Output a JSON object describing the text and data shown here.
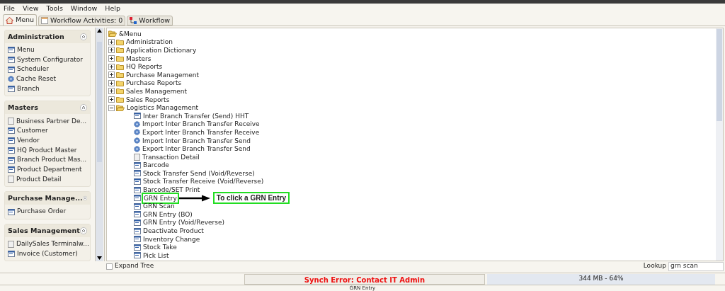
{
  "menu_bar": [
    "File",
    "View",
    "Tools",
    "Window",
    "Help"
  ],
  "tabs": [
    {
      "label": "Menu",
      "selected": true
    },
    {
      "label": "Workflow Activities: 0",
      "selected": false
    },
    {
      "label": "Workflow",
      "selected": false
    }
  ],
  "sidebar": {
    "panels": [
      {
        "title": "Administration",
        "items": [
          {
            "label": "Menu",
            "kind": "window"
          },
          {
            "label": "System Configurator",
            "kind": "window"
          },
          {
            "label": "Scheduler",
            "kind": "window"
          },
          {
            "label": "Cache Reset",
            "kind": "process"
          },
          {
            "label": "Branch",
            "kind": "window"
          }
        ]
      },
      {
        "title": "Masters",
        "items": [
          {
            "label": "Business Partner De...",
            "kind": "report"
          },
          {
            "label": "Customer",
            "kind": "window"
          },
          {
            "label": "Vendor",
            "kind": "window"
          },
          {
            "label": "HQ Product Master",
            "kind": "window"
          },
          {
            "label": "Branch Product Mas...",
            "kind": "window"
          },
          {
            "label": "Product Department",
            "kind": "window"
          },
          {
            "label": "Product Detail",
            "kind": "report"
          }
        ]
      },
      {
        "title": "Purchase Manage...",
        "items": [
          {
            "label": "Purchase Order",
            "kind": "window"
          }
        ]
      },
      {
        "title": "Sales Management",
        "items": [
          {
            "label": "DailySales Terminalw...",
            "kind": "report"
          },
          {
            "label": "Invoice (Customer)",
            "kind": "window"
          }
        ]
      }
    ]
  },
  "tree": {
    "label": "&Menu",
    "children": [
      {
        "label": "Administration",
        "kind": "folder",
        "expanded": false
      },
      {
        "label": "Application Dictionary",
        "kind": "folder",
        "expanded": false
      },
      {
        "label": "Masters",
        "kind": "folder",
        "expanded": false
      },
      {
        "label": "HQ Reports",
        "kind": "folder",
        "expanded": false
      },
      {
        "label": "Purchase Management",
        "kind": "folder",
        "expanded": false
      },
      {
        "label": "Purchase Reports",
        "kind": "folder",
        "expanded": false
      },
      {
        "label": "Sales Management",
        "kind": "folder",
        "expanded": false
      },
      {
        "label": "Sales Reports",
        "kind": "folder",
        "expanded": false
      },
      {
        "label": "Logistics Management",
        "kind": "folder",
        "expanded": true,
        "children": [
          {
            "label": "Inter Branch Transfer (Send) HHT",
            "kind": "window"
          },
          {
            "label": "Import Inter Branch Transfer Receive",
            "kind": "process"
          },
          {
            "label": "Export Inter Branch Transfer Receive",
            "kind": "process"
          },
          {
            "label": "Import Inter Branch Transfer Send",
            "kind": "process"
          },
          {
            "label": "Export Inter Branch Transfer Send",
            "kind": "process"
          },
          {
            "label": "Transaction Detail",
            "kind": "report"
          },
          {
            "label": "Barcode",
            "kind": "window"
          },
          {
            "label": "Stock Transfer Send (Void/Reverse)",
            "kind": "window"
          },
          {
            "label": "Stock Transfer Receive (Void/Reverse)",
            "kind": "window"
          },
          {
            "label": "Barcode/SET Print",
            "kind": "window"
          },
          {
            "label": "GRN Entry",
            "kind": "window",
            "annotation": "To click a GRN Entry"
          },
          {
            "label": "GRN Scan",
            "kind": "window"
          },
          {
            "label": "GRN Entry (BO)",
            "kind": "window"
          },
          {
            "label": "GRN Entry (Void/Reverse)",
            "kind": "window"
          },
          {
            "label": "Deactivate Product",
            "kind": "window"
          },
          {
            "label": "Inventory Change",
            "kind": "window"
          },
          {
            "label": "Stock Take",
            "kind": "window"
          },
          {
            "label": "Pick List",
            "kind": "window"
          }
        ]
      }
    ]
  },
  "expand_tree": {
    "label": "Expand Tree",
    "checked": false
  },
  "lookup": {
    "label": "Lookup",
    "value": "grn scan"
  },
  "status_bar": {
    "message": "Synch Error: Contact IT Admin",
    "memory": "344 MB - 64%",
    "hint": "GRN Entry"
  }
}
